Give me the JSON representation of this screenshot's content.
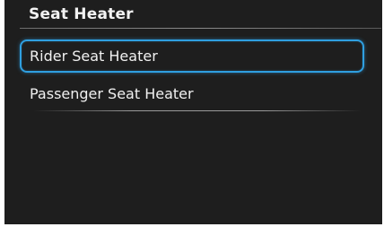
{
  "header": {
    "title": "Seat Heater"
  },
  "menu": {
    "items": [
      {
        "label": "Rider Seat Heater",
        "selected": true
      },
      {
        "label": "Passenger Seat Heater",
        "selected": false
      }
    ]
  },
  "colors": {
    "background": "#1e1e1e",
    "text": "#f0f0f0",
    "selection_border": "#2f9fe0"
  }
}
